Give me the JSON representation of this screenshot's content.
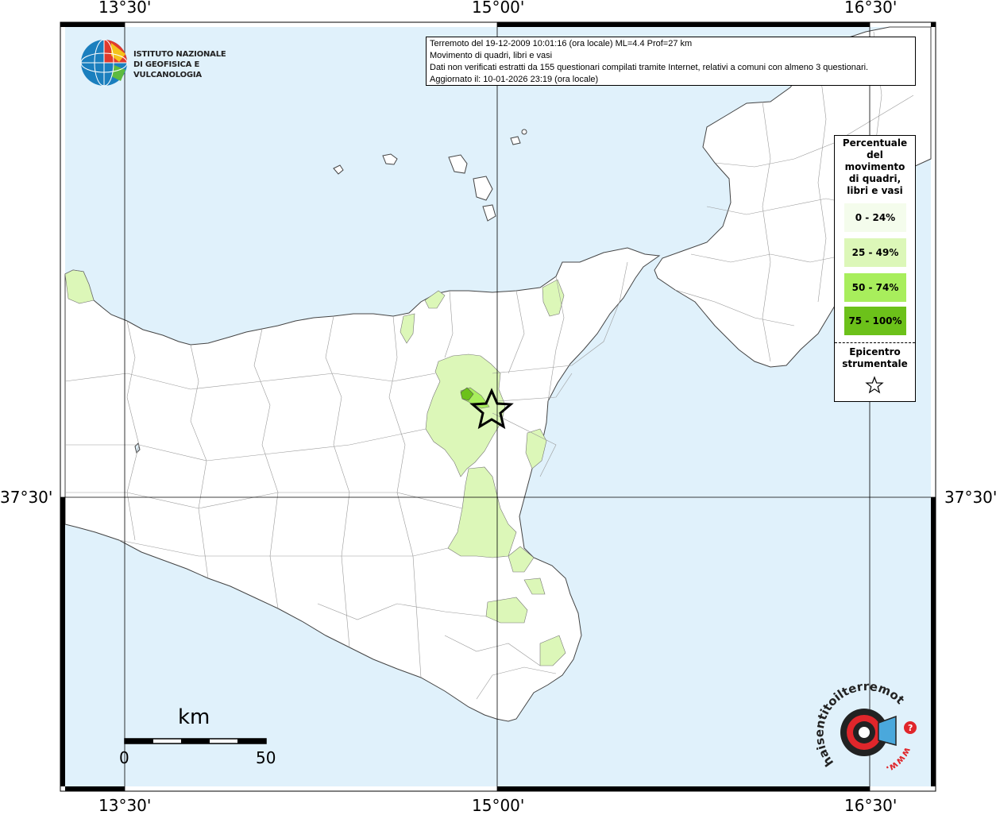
{
  "coords": {
    "top": [
      "13°30'",
      "15°00'",
      "16°30'"
    ],
    "bottom": [
      "13°30'",
      "15°00'",
      "16°30'"
    ],
    "left": "37°30'",
    "right": "37°30'"
  },
  "logo": {
    "line1": "ISTITUTO NAZIONALE",
    "line2": "DI GEOFISICA E VULCANOLOGIA"
  },
  "info": {
    "line1": "Terremoto del 19-12-2009 10:01:16 (ora locale) ML=4.4 Prof=27 km",
    "line2": "Movimento di quadri, libri e vasi",
    "line3": "Dati non verificati estratti da 155 questionari compilati tramite Internet, relativi a comuni con almeno 3 questionari.",
    "line4": "Aggiornato il: 10-01-2026 23:19 (ora locale)"
  },
  "legend": {
    "title": [
      "Percentuale",
      "del",
      "movimento",
      "di quadri,",
      "libri e vasi"
    ],
    "items": [
      {
        "label": "0 - 24%",
        "color": "#f4fcec"
      },
      {
        "label": "25 - 49%",
        "color": "#dcf7b8"
      },
      {
        "label": "50 - 74%",
        "color": "#a8ee5c"
      },
      {
        "label": "75 - 100%",
        "color": "#6cc11a"
      }
    ],
    "epicenter": [
      "Epicentro",
      "strumentale"
    ]
  },
  "scale": {
    "unit": "km",
    "min": "0",
    "max": "50"
  },
  "colors": {
    "sea": "#e0f1fb",
    "land": "#ffffff",
    "border": "#000000"
  },
  "hs_logo": {
    "text": "haisentitoilterremoto.it",
    "www": "www."
  }
}
